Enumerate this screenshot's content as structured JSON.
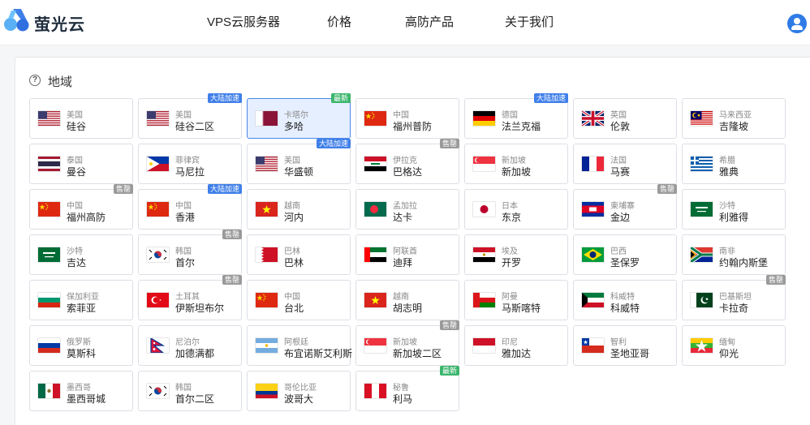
{
  "header": {
    "brand": "萤光云",
    "nav": [
      "VPS云服务器",
      "价格",
      "高防产品",
      "关于我们"
    ]
  },
  "section": {
    "icon_text": "?",
    "title": "地域"
  },
  "colors": {
    "accent": "#3f7fe8",
    "new": "#3bb56c",
    "sold_out": "#9a9a9a",
    "selected_bg": "#e6efff"
  },
  "regions": [
    {
      "country": "美国",
      "city": "硅谷",
      "flag": "us"
    },
    {
      "country": "美国",
      "city": "硅谷二区",
      "flag": "us",
      "badge": "大陆加速",
      "badge_type": "accel"
    },
    {
      "country": "卡塔尔",
      "city": "多哈",
      "flag": "qa",
      "badge": "最新",
      "badge_type": "new",
      "selected": true
    },
    {
      "country": "中国",
      "city": "福州普防",
      "flag": "cn"
    },
    {
      "country": "德国",
      "city": "法兰克福",
      "flag": "de",
      "badge": "大陆加速",
      "badge_type": "accel"
    },
    {
      "country": "英国",
      "city": "伦敦",
      "flag": "gb"
    },
    {
      "country": "马来西亚",
      "city": "吉隆坡",
      "flag": "my"
    },
    {
      "country": "泰国",
      "city": "曼谷",
      "flag": "th"
    },
    {
      "country": "菲律宾",
      "city": "马尼拉",
      "flag": "ph"
    },
    {
      "country": "美国",
      "city": "华盛顿",
      "flag": "us",
      "badge": "大陆加速",
      "badge_type": "accel"
    },
    {
      "country": "伊拉克",
      "city": "巴格达",
      "flag": "iq",
      "badge": "售罄",
      "badge_type": "sold"
    },
    {
      "country": "新加坡",
      "city": "新加坡",
      "flag": "sg"
    },
    {
      "country": "法国",
      "city": "马赛",
      "flag": "fr"
    },
    {
      "country": "希腊",
      "city": "雅典",
      "flag": "gr"
    },
    {
      "country": "中国",
      "city": "福州高防",
      "flag": "cn",
      "badge": "售罄",
      "badge_type": "sold"
    },
    {
      "country": "中国",
      "city": "香港",
      "flag": "cn",
      "badge": "大陆加速",
      "badge_type": "accel"
    },
    {
      "country": "越南",
      "city": "河内",
      "flag": "vn"
    },
    {
      "country": "孟加拉",
      "city": "达卡",
      "flag": "bd"
    },
    {
      "country": "日本",
      "city": "东京",
      "flag": "jp"
    },
    {
      "country": "柬埔寨",
      "city": "金边",
      "flag": "kh",
      "badge": "售罄",
      "badge_type": "sold"
    },
    {
      "country": "沙特",
      "city": "利雅得",
      "flag": "sa"
    },
    {
      "country": "沙特",
      "city": "吉达",
      "flag": "sa"
    },
    {
      "country": "韩国",
      "city": "首尔",
      "flag": "kr",
      "badge": "售罄",
      "badge_type": "sold"
    },
    {
      "country": "巴林",
      "city": "巴林",
      "flag": "bh"
    },
    {
      "country": "阿联酋",
      "city": "迪拜",
      "flag": "ae"
    },
    {
      "country": "埃及",
      "city": "开罗",
      "flag": "eg"
    },
    {
      "country": "巴西",
      "city": "圣保罗",
      "flag": "br"
    },
    {
      "country": "南非",
      "city": "约翰内斯堡",
      "flag": "za"
    },
    {
      "country": "保加利亚",
      "city": "索菲亚",
      "flag": "bg"
    },
    {
      "country": "土耳其",
      "city": "伊斯坦布尔",
      "flag": "tr",
      "badge": "售罄",
      "badge_type": "sold"
    },
    {
      "country": "中国",
      "city": "台北",
      "flag": "cn"
    },
    {
      "country": "越南",
      "city": "胡志明",
      "flag": "vn"
    },
    {
      "country": "阿曼",
      "city": "马斯喀特",
      "flag": "om"
    },
    {
      "country": "科威特",
      "city": "科威特",
      "flag": "kw"
    },
    {
      "country": "巴基斯坦",
      "city": "卡拉奇",
      "flag": "pk",
      "badge": "售罄",
      "badge_type": "sold"
    },
    {
      "country": "俄罗斯",
      "city": "莫斯科",
      "flag": "ru"
    },
    {
      "country": "尼泊尔",
      "city": "加德满都",
      "flag": "np"
    },
    {
      "country": "阿根廷",
      "city": "布宜诺斯艾利斯",
      "flag": "ar"
    },
    {
      "country": "新加坡",
      "city": "新加坡二区",
      "flag": "sg",
      "badge": "售罄",
      "badge_type": "sold"
    },
    {
      "country": "印尼",
      "city": "雅加达",
      "flag": "id"
    },
    {
      "country": "智利",
      "city": "圣地亚哥",
      "flag": "cl"
    },
    {
      "country": "缅甸",
      "city": "仰光",
      "flag": "mm"
    },
    {
      "country": "墨西哥",
      "city": "墨西哥城",
      "flag": "mx"
    },
    {
      "country": "韩国",
      "city": "首尔二区",
      "flag": "kr"
    },
    {
      "country": "哥伦比亚",
      "city": "波哥大",
      "flag": "co"
    },
    {
      "country": "秘鲁",
      "city": "利马",
      "flag": "pe",
      "badge": "最新",
      "badge_type": "new"
    }
  ]
}
